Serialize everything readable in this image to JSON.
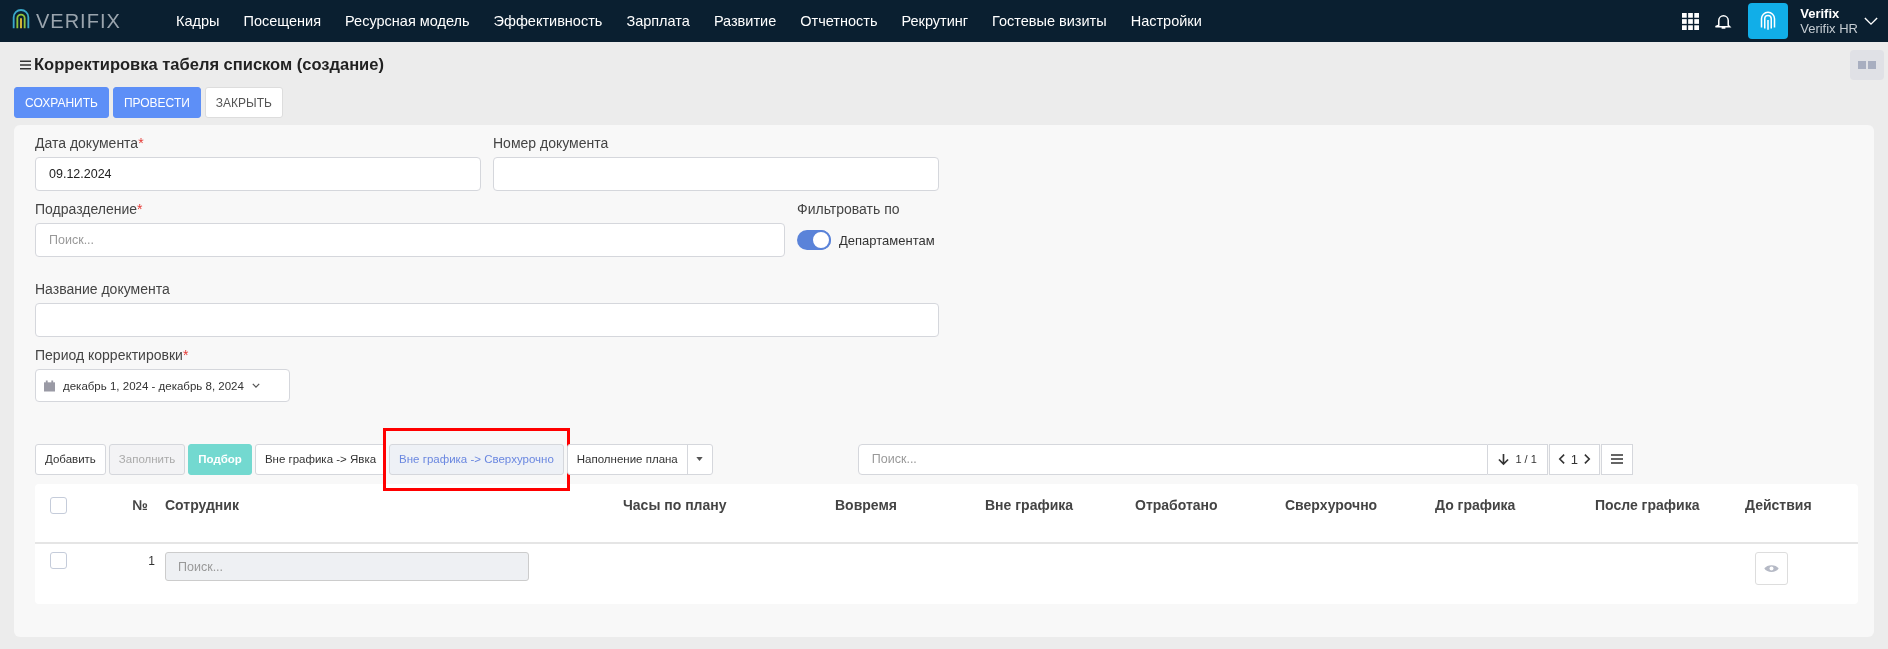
{
  "navbar": {
    "logo": "VERIFIX",
    "menu": [
      "Кадры",
      "Посещения",
      "Ресурсная модель",
      "Эффективность",
      "Зарплата",
      "Развитие",
      "Отчетность",
      "Рекрутинг",
      "Гостевые визиты",
      "Настройки"
    ],
    "user": {
      "name": "Verifix",
      "company": "Verifix HR"
    }
  },
  "page": {
    "title": "Корректировка табеля списком (создание)"
  },
  "actions": [
    {
      "label": "СОХРАНИТЬ",
      "kind": "primary"
    },
    {
      "label": "ПРОВЕСТИ",
      "kind": "primary"
    },
    {
      "label": "ЗАКРЫТЬ",
      "kind": "default"
    }
  ],
  "form": {
    "date": {
      "label": "Дата документа",
      "mark": "*",
      "value": "09.12.2024"
    },
    "number": {
      "label": "Номер документа"
    },
    "division": {
      "label": "Подразделение",
      "mark": "*",
      "placeholder": "Поиск..."
    },
    "filter": {
      "label": "Фильтровать по",
      "option": "Департаментам",
      "on": true
    },
    "name": {
      "label": "Название документа"
    },
    "period": {
      "label": "Период корректировки",
      "mark": "*",
      "value": "декабрь 1, 2024 - декабрь 8, 2024"
    }
  },
  "toolbar": {
    "buttons": [
      {
        "label": "Добавить",
        "kind": "default",
        "disabled": false,
        "selected": false
      },
      {
        "label": "Заполнить",
        "kind": "default",
        "disabled": true,
        "selected": false
      },
      {
        "label": "Подбор",
        "kind": "primary",
        "disabled": false,
        "selected": false
      },
      {
        "label": "Вне графика -> Явка",
        "kind": "default",
        "disabled": false,
        "selected": false
      },
      {
        "label": "Вне графика -> Сверхурочно",
        "kind": "default",
        "disabled": false,
        "selected": true,
        "highlighted": true
      },
      {
        "label": "Наполнение плана",
        "kind": "split",
        "disabled": false,
        "selected": false
      }
    ],
    "search": {
      "placeholder": "Поиск..."
    },
    "count": "1 / 1",
    "page": "1"
  },
  "table": {
    "all_checked": false,
    "columns": [
      "№",
      "Сотрудник",
      "Часы по плану",
      "Вовремя",
      "Вне графика",
      "Отработано",
      "Сверхурочно",
      "До графика",
      "После графика",
      "Действия"
    ],
    "rows": [
      {
        "checked": false,
        "number": "1",
        "employee_placeholder": "Поиск..."
      }
    ]
  }
}
